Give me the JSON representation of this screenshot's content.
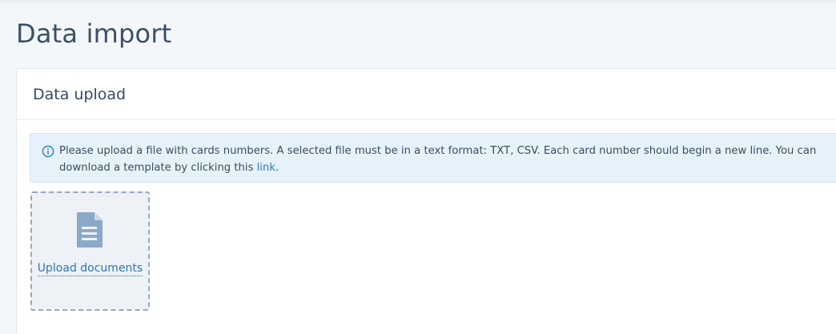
{
  "page": {
    "title": "Data import"
  },
  "card": {
    "title": "Data upload",
    "info": {
      "icon": "info-circle-icon",
      "text_before": "Please upload a file with cards numbers. A selected file must be in a text format: TXT, CSV. Each card number should begin a new line. You can download a template by clicking this ",
      "link_text": "link",
      "text_after": "."
    },
    "upload": {
      "icon": "document-icon",
      "label": "Upload documents"
    }
  },
  "colors": {
    "title": "#3a5068",
    "link": "#2f7bb8",
    "info_background": "#e5f2fb",
    "upload_border": "#9aa9bc",
    "icon": "#8aa9c9"
  }
}
